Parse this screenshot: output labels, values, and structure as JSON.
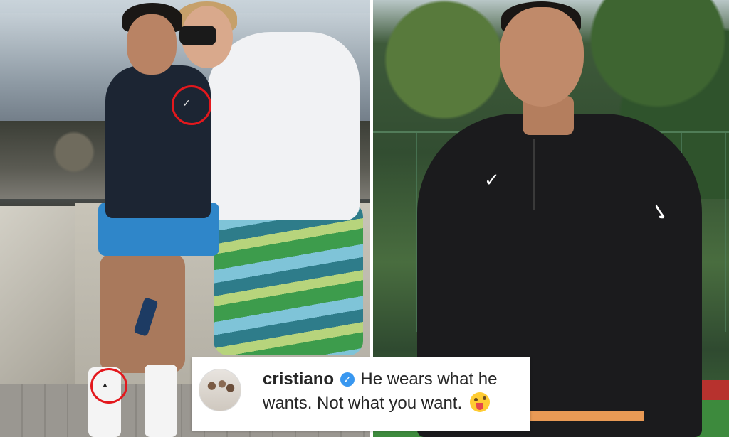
{
  "comment": {
    "username": "cristiano",
    "text": "He wears what he wants. Not what you want.",
    "verified_icon": "verified-badge-icon",
    "emoji_icon": "winking-face-with-tongue-emoji",
    "verified_color": "#3897f0"
  },
  "annotations": {
    "circle_color": "#e3181d",
    "circled_items": [
      "nike-logo",
      "adidas-logo"
    ]
  }
}
